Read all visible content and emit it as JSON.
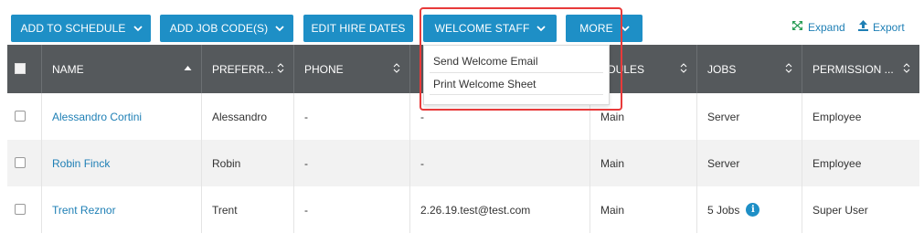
{
  "toolbar": {
    "add_to_schedule": "ADD TO SCHEDULE",
    "add_job_codes": "ADD JOB CODE(S)",
    "edit_hire_dates": "EDIT HIRE DATES",
    "welcome_staff": "WELCOME STAFF",
    "more": "MORE",
    "expand": "Expand",
    "export": "Export"
  },
  "dropdown": {
    "items": [
      "Send Welcome Email",
      "Print Welcome Sheet"
    ]
  },
  "columns": [
    "NAME",
    "PREFERR...",
    "PHONE",
    "",
    "EDULES",
    "JOBS",
    "PERMISSION ..."
  ],
  "rows": [
    {
      "name": "Alessandro Cortini",
      "preferred": "Alessandro",
      "phone": "-",
      "email": "-",
      "schedules": "Main",
      "jobs": "Server",
      "permission": "Employee"
    },
    {
      "name": "Robin Finck",
      "preferred": "Robin",
      "phone": "-",
      "email": "-",
      "schedules": "Main",
      "jobs": "Server",
      "permission": "Employee"
    },
    {
      "name": "Trent Reznor",
      "preferred": "Trent",
      "phone": "-",
      "email": "2.26.19.test@test.com",
      "schedules": "Main",
      "jobs": "5 Jobs",
      "permission": "Super User"
    }
  ],
  "colors": {
    "primary": "#1e8fc6",
    "header": "#55595c",
    "link": "#1e7fb5",
    "highlight": "#e83a3a"
  }
}
